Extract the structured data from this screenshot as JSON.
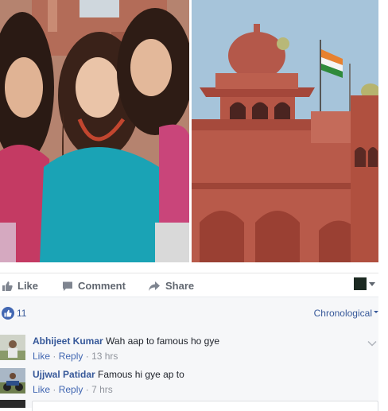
{
  "actions": {
    "like_label": "Like",
    "comment_label": "Comment",
    "share_label": "Share"
  },
  "reactions": {
    "like_count": "11",
    "sort_label": "Chronological"
  },
  "comments": [
    {
      "author": "Abhijeet Kumar",
      "text": "Wah aap to famous ho gye",
      "like": "Like",
      "reply": "Reply",
      "time": "13 hrs"
    },
    {
      "author": "Ujjwal Patidar",
      "text": "Famous hi gye ap to",
      "like": "Like",
      "reply": "Reply",
      "time": "7 hrs"
    }
  ],
  "colors": {
    "link_blue": "#365899",
    "brand_blue": "#4267b2",
    "muted_gray": "#90949c",
    "panel_bg": "#f6f7f9"
  },
  "icons": [
    "thumbs-up-icon",
    "comment-bubble-icon",
    "share-arrow-icon",
    "audience-avatar-icon",
    "like-badge-icon",
    "chevron-down-icon"
  ]
}
